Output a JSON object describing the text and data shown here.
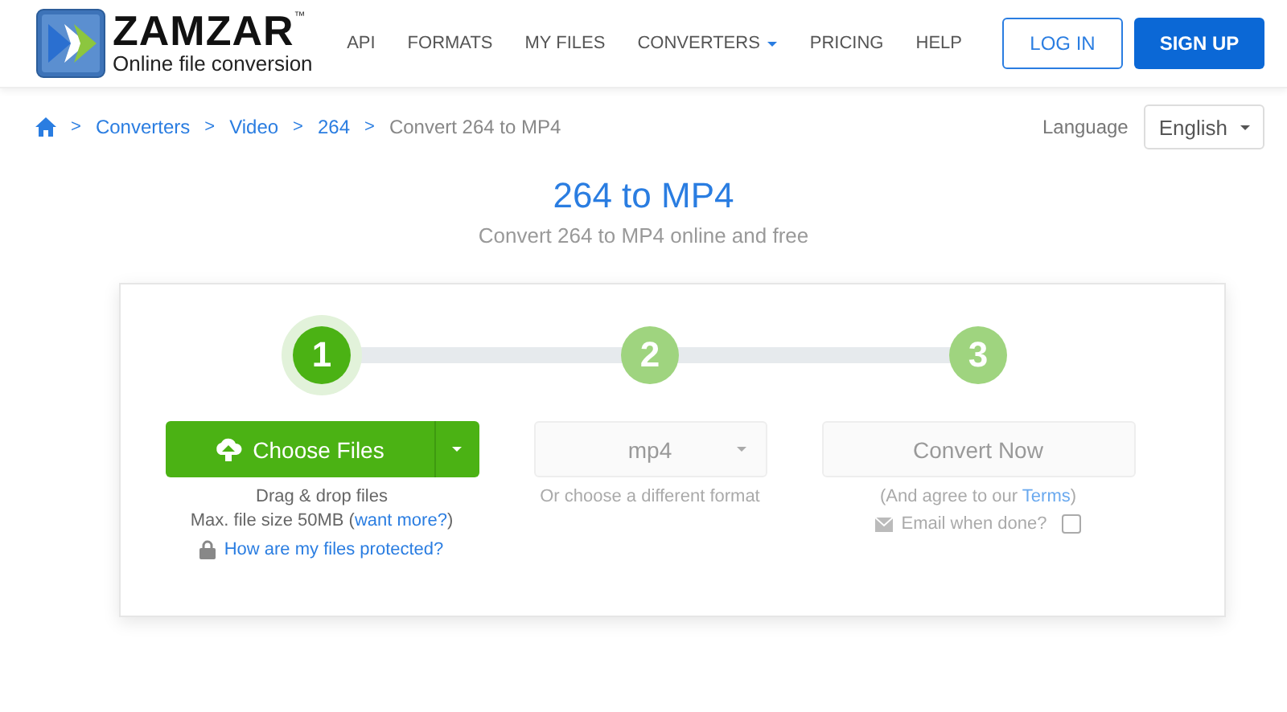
{
  "header": {
    "logo": {
      "name": "ZAMZAR",
      "trademark": "™",
      "tagline": "Online file conversion"
    },
    "nav": [
      {
        "label": "API",
        "dropdown": false
      },
      {
        "label": "FORMATS",
        "dropdown": false
      },
      {
        "label": "MY FILES",
        "dropdown": false
      },
      {
        "label": "CONVERTERS",
        "dropdown": true
      },
      {
        "label": "PRICING",
        "dropdown": false
      },
      {
        "label": "HELP",
        "dropdown": false
      }
    ],
    "login": "LOG IN",
    "signup": "SIGN UP"
  },
  "breadcrumb_separator": ">",
  "breadcrumb": [
    {
      "label": "Converters",
      "link": true
    },
    {
      "label": "Video",
      "link": true
    },
    {
      "label": "264",
      "link": true
    },
    {
      "label": "Convert 264 to MP4",
      "link": false
    }
  ],
  "language": {
    "label": "Language",
    "value": "English"
  },
  "title": "264 to MP4",
  "subtitle": "Convert 264 to MP4 online and free",
  "steps": [
    {
      "number": "1",
      "selected": true
    },
    {
      "number": "2",
      "selected": false
    },
    {
      "number": "3",
      "selected": false
    }
  ],
  "choose": {
    "label": "Choose Files",
    "drag": "Drag & drop files",
    "max": "Max. file size 50MB",
    "more_open": "(",
    "more": "want more?",
    "more_close": ")",
    "protected": "How are my files protected?"
  },
  "format": {
    "value": "mp4",
    "disabled": true,
    "hint": "Or choose a different format"
  },
  "convert": {
    "label": "Convert Now",
    "disabled": true,
    "agree_before": "(And agree to our ",
    "terms": "Terms",
    "agree_after": ")",
    "email": "Email when done?",
    "email_checked": false
  }
}
